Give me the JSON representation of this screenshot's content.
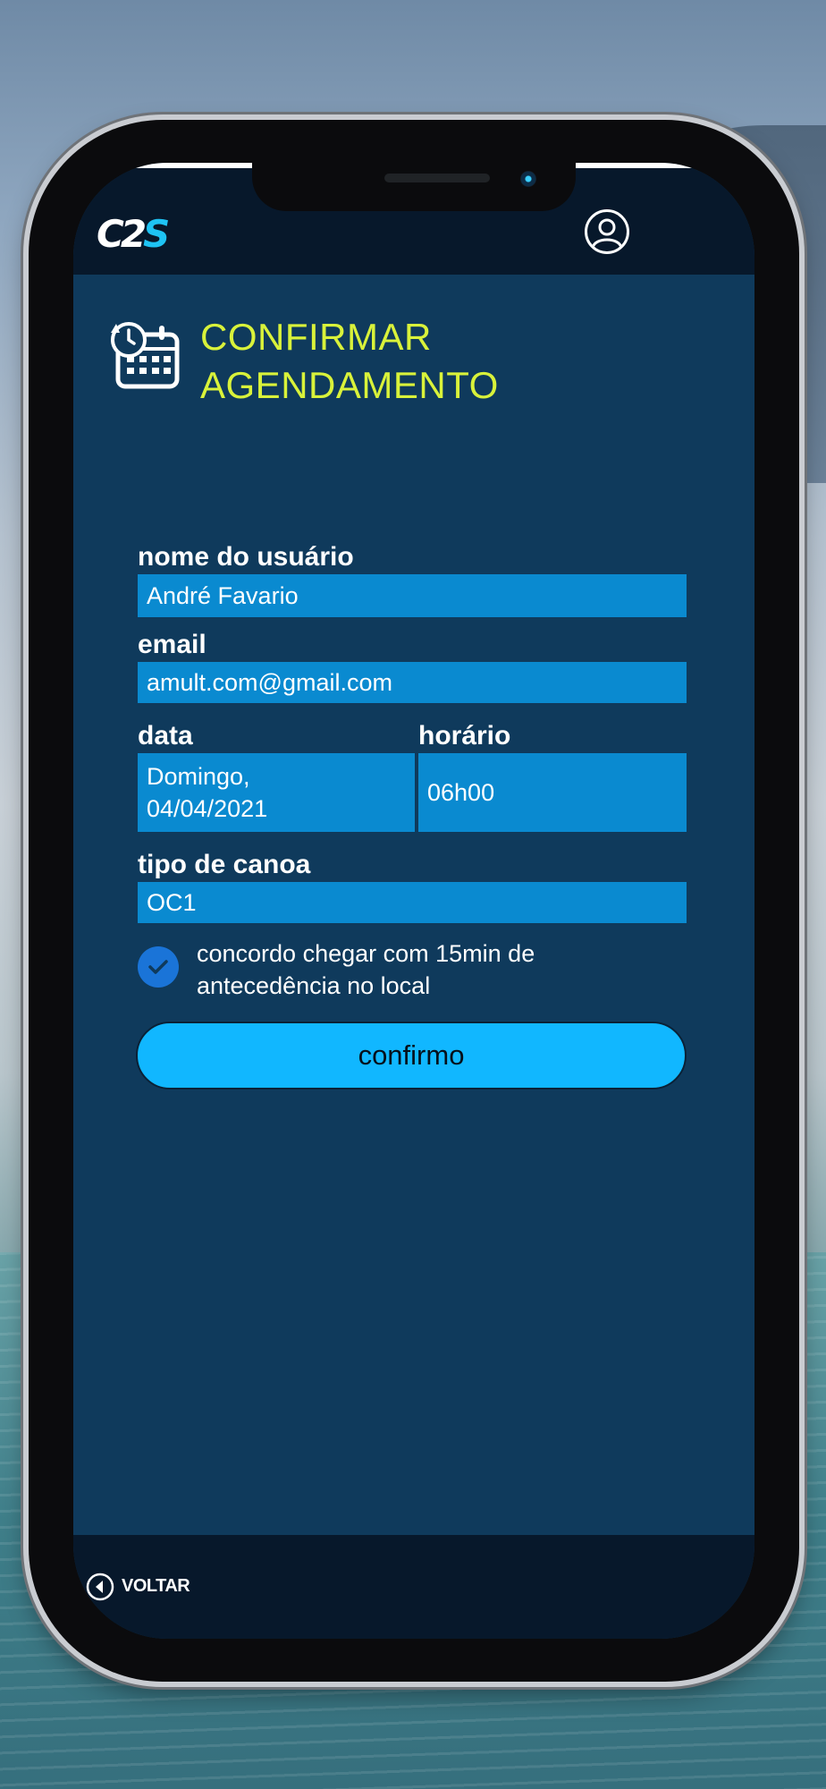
{
  "header": {
    "logo_text": "C2S",
    "profile_icon": "user-circle-icon"
  },
  "page": {
    "title_line1": "CONFIRMAR",
    "title_line2": "AGENDAMENTO",
    "title_icon": "calendar-clock-icon",
    "title_color": "#d9f23a"
  },
  "form": {
    "user_label": "nome do usuário",
    "user_value": "André Favario",
    "email_label": "email",
    "email_value": "amult.com@gmail.com",
    "date_label": "data",
    "date_value": "Domingo,\n04/04/2021",
    "time_label": "horário",
    "time_value": "06h00",
    "canoe_label": "tipo de canoa",
    "canoe_value": "OC1",
    "agree_checked": true,
    "agree_text": "concordo chegar com 15min de antecedência no local",
    "confirm_label": "confirmo"
  },
  "footer": {
    "back_label": "VOLTAR",
    "back_icon": "chevron-left-circle-icon"
  },
  "colors": {
    "screen_bg": "#0f3a5c",
    "bar_bg": "#07182b",
    "field_bg": "#0a8ad0",
    "button_bg": "#11b7ff",
    "check_bg": "#1a74d8"
  }
}
